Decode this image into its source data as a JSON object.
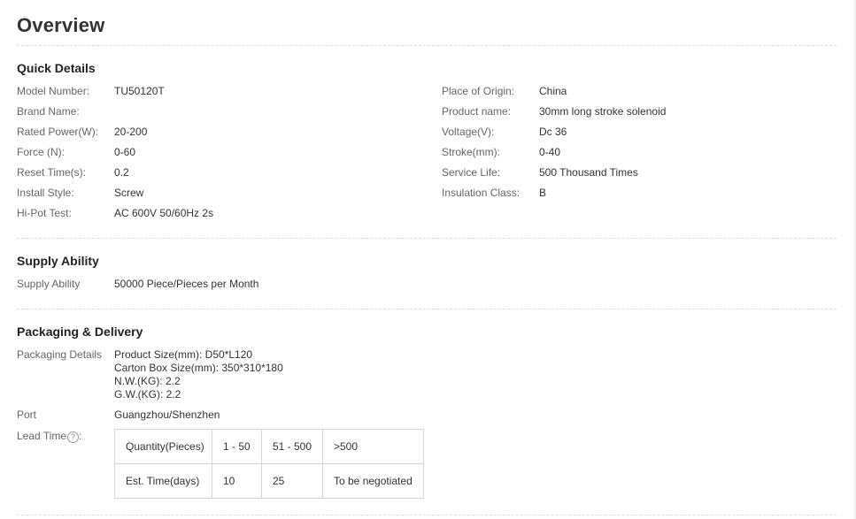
{
  "title": "Overview",
  "quick_details": {
    "heading": "Quick Details",
    "left": [
      {
        "label": "Model Number:",
        "value": "TU50120T"
      },
      {
        "label": "Brand Name:",
        "value": ""
      },
      {
        "label": "Rated Power(W):",
        "value": "20-200"
      },
      {
        "label": "Force (N):",
        "value": "0-60"
      },
      {
        "label": "Reset Time(s):",
        "value": "0.2"
      },
      {
        "label": "Install Style:",
        "value": "Screw"
      },
      {
        "label": "Hi-Pot Test:",
        "value": "AC 600V 50/60Hz 2s"
      }
    ],
    "right": [
      {
        "label": "Place of Origin:",
        "value": "China"
      },
      {
        "label": "Product name:",
        "value": "30mm long stroke solenoid"
      },
      {
        "label": "Voltage(V):",
        "value": "Dc 36"
      },
      {
        "label": "Stroke(mm):",
        "value": "0-40"
      },
      {
        "label": "Service Life:",
        "value": "500 Thousand Times"
      },
      {
        "label": "Insulation Class:",
        "value": "B"
      }
    ]
  },
  "supply_ability": {
    "heading": "Supply Ability",
    "label": "Supply Ability",
    "value": "50000 Piece/Pieces per Month"
  },
  "packaging": {
    "heading": "Packaging & Delivery",
    "details_label": "Packaging Details",
    "details_lines": [
      "Product Size(mm): D50*L120",
      "Carton Box Size(mm): 350*310*180",
      "N.W.(KG): 2.2",
      "G.W.(KG): 2.2"
    ],
    "port_label": "Port",
    "port_value": "Guangzhou/Shenzhen",
    "lead_time_label": "Lead Time",
    "help_icon": "question-circle-icon",
    "lead_table": {
      "row1": [
        "Quantity(Pieces)",
        "1 - 50",
        "51 - 500",
        ">500"
      ],
      "row2": [
        "Est. Time(days)",
        "10",
        "25",
        "To be negotiated"
      ]
    }
  }
}
